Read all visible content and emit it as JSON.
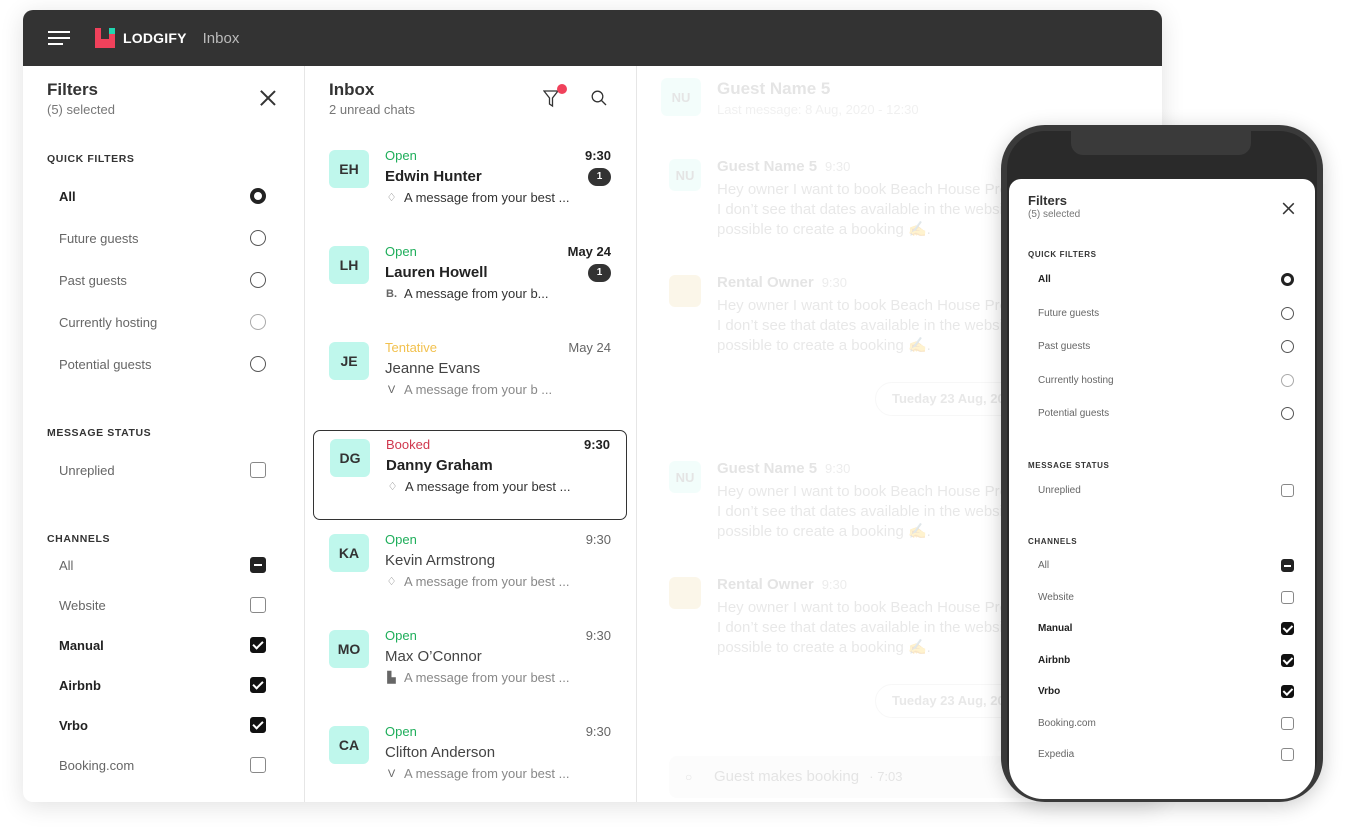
{
  "topbar": {
    "brand": "LODGIFY",
    "section": "Inbox",
    "logo_colors": [
      "#f0415b",
      "#20d6b0"
    ]
  },
  "filters": {
    "title": "Filters",
    "subtitle": "(5) selected",
    "quick_title": "QUICK FILTERS",
    "quick": [
      {
        "label": "All",
        "selected": true
      },
      {
        "label": "Future guests",
        "selected": false
      },
      {
        "label": "Past guests",
        "selected": false
      },
      {
        "label": "Currently hosting",
        "selected": false
      },
      {
        "label": "Potential guests",
        "selected": false
      }
    ],
    "status_title": "MESSAGE STATUS",
    "status": [
      {
        "label": "Unreplied",
        "state": "off"
      }
    ],
    "channels_title": "CHANNELS",
    "channels": [
      {
        "label": "All",
        "state": "ind"
      },
      {
        "label": "Website",
        "state": "off"
      },
      {
        "label": "Manual",
        "state": "on"
      },
      {
        "label": "Airbnb",
        "state": "on"
      },
      {
        "label": "Vrbo",
        "state": "on"
      },
      {
        "label": "Booking.com",
        "state": "off"
      },
      {
        "label": "Expedia",
        "state": "off"
      }
    ]
  },
  "inbox": {
    "title": "Inbox",
    "subtitle": "2 unread chats",
    "status_colors": {
      "Open": "#1fae5b",
      "Tentative": "#f2c14e",
      "Booked": "#d0384e"
    },
    "conversations": [
      {
        "initials": "EH",
        "status": "Open",
        "name": "Edwin Hunter",
        "channel": "airbnb",
        "message": "A message from your best ...",
        "time": "9:30",
        "unread": "1",
        "selected": false
      },
      {
        "initials": "LH",
        "status": "Open",
        "name": "Lauren Howell",
        "channel": "booking",
        "message": "A message from your b...",
        "time": "May 24",
        "unread": "1",
        "selected": false
      },
      {
        "initials": "JE",
        "status": "Tentative",
        "name": "Jeanne Evans",
        "channel": "vrbo",
        "message": "A message from your b ...",
        "time": "May 24",
        "unread": null,
        "selected": false
      },
      {
        "initials": "DG",
        "status": "Booked",
        "name": "Danny Graham",
        "channel": "airbnb",
        "message": "A message from your best ...",
        "time": "9:30",
        "unread": null,
        "selected": true,
        "bold": true
      },
      {
        "initials": "KA",
        "status": "Open",
        "name": "Kevin Armstrong",
        "channel": "airbnb",
        "message": "A message from your best ...",
        "time": "9:30",
        "unread": null,
        "selected": false
      },
      {
        "initials": "MO",
        "status": "Open",
        "name": "Max O’Connor",
        "channel": "manual",
        "message": "A message from your best ...",
        "time": "9:30",
        "unread": null,
        "selected": false
      },
      {
        "initials": "CA",
        "status": "Open",
        "name": "Clifton Anderson",
        "channel": "vrbo",
        "message": "A message from your best ...",
        "time": "9:30",
        "unread": null,
        "selected": false
      }
    ]
  },
  "chat": {
    "header": {
      "initials": "NU",
      "name": "Guest Name 5",
      "last": "Last message: 8 Aug, 2020 - 12:30"
    },
    "messages": [
      {
        "avatar": "NU",
        "author": "Guest Name 5",
        "time": "9:30",
        "lines": [
          "Hey owner I want to book Beach House Pro",
          "I don’t see that dates available in the websi",
          "possible to create a booking ✍."
        ]
      },
      {
        "avatar": "house",
        "author": "Rental Owner",
        "time": "9:30",
        "lines": [
          "Hey owner I want to book Beach House Pro",
          "I don’t see that dates available in the websi",
          "possible to create a booking ✍."
        ]
      },
      {
        "date": "Tueday 23 Aug, 202"
      },
      {
        "avatar": "NU",
        "author": "Guest Name 5",
        "time": "9:30",
        "lines": [
          "Hey owner I want to book Beach House Pro",
          "I don’t see that dates available in the websi",
          "possible to create a booking ✍."
        ]
      },
      {
        "avatar": "house",
        "author": "Rental Owner",
        "time": "9:30",
        "lines": [
          "Hey owner I want to book Beach House Pro",
          "I don’t see that dates available in the websi",
          "possible to create a booking ✍."
        ]
      },
      {
        "date": "Tueday 23 Aug, 202"
      }
    ],
    "event": {
      "label": "Guest makes booking",
      "time": "· 7:03"
    }
  }
}
